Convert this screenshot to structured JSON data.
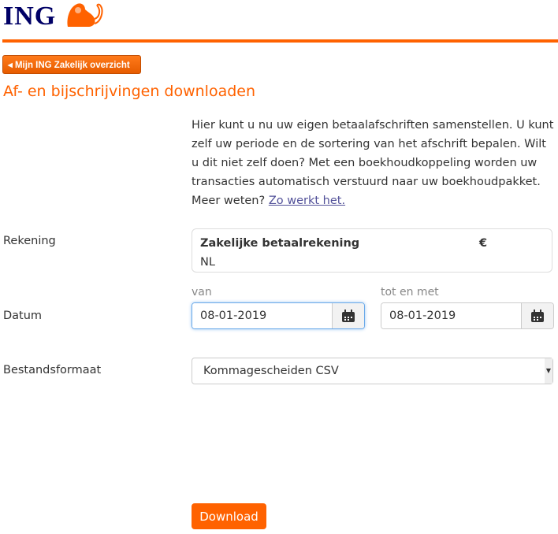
{
  "header": {
    "logo": "ING"
  },
  "back_button": "Mijn ING Zakelijk overzicht",
  "page_title": "Af- en bijschrijvingen downloaden",
  "intro": {
    "text": "Hier kunt u nu uw eigen betaalafschriften samenstellen. U kunt zelf uw periode en de sortering van het afschrift bepalen. Wilt u dit niet zelf doen? Met een boekhoudkoppeling worden uw transacties automatisch verstuurd naar uw boekhoudpakket. Meer weten? ",
    "link": "Zo werkt het."
  },
  "account": {
    "label": "Rekening",
    "name": "Zakelijke betaalrekening",
    "currency": "€",
    "iban": "NL"
  },
  "date": {
    "label": "Datum",
    "from_label": "van",
    "from_value": "08-01-2019",
    "to_label": "tot en met",
    "to_value": "08-01-2019"
  },
  "format": {
    "label": "Bestandsformaat",
    "selected": "Kommagescheiden CSV"
  },
  "download_button": "Download",
  "colors": {
    "brand_orange": "#ff6200",
    "brand_blue": "#000066"
  }
}
